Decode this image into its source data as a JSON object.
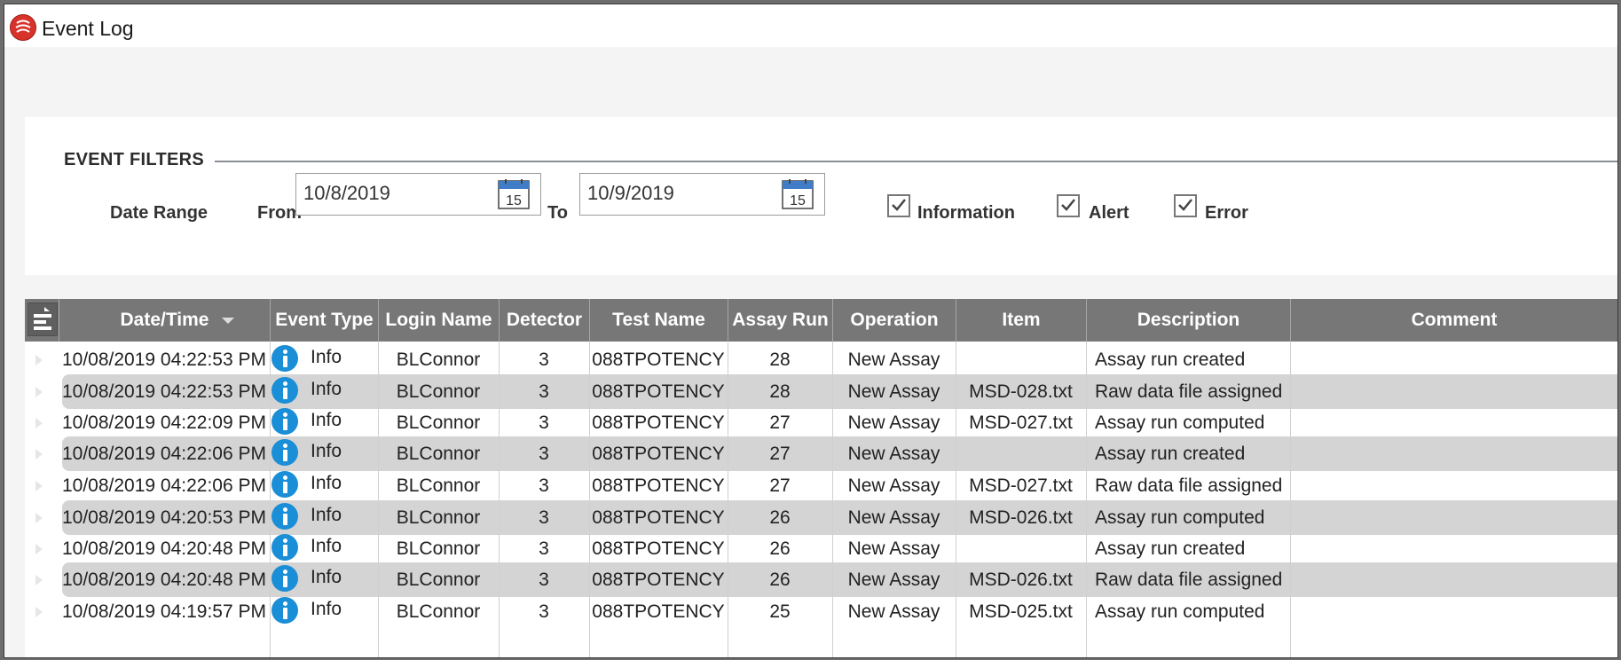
{
  "window": {
    "title": "Event Log"
  },
  "filters": {
    "section_title": "EVENT FILTERS",
    "date_range_label": "Date Range",
    "from_label": "From",
    "from_value": "10/8/2019",
    "to_label": "To",
    "to_value": "10/9/2019",
    "calendar_day": "15",
    "checkboxes": [
      {
        "label": "Information",
        "checked": true
      },
      {
        "label": "Alert",
        "checked": true
      },
      {
        "label": "Error",
        "checked": true
      }
    ]
  },
  "grid": {
    "columns": [
      "Date/Time",
      "Event Type",
      "Login Name",
      "Detector",
      "Test Name",
      "Assay Run",
      "Operation",
      "Item",
      "Description",
      "Comment"
    ],
    "sorted_column": "Date/Time",
    "sort_direction": "descending",
    "rows": [
      [
        "10/08/2019 04:22:53 PM",
        "Info",
        "BLConnor",
        "3",
        "088TPOTENCY",
        "28",
        "New Assay",
        "",
        "Assay run created",
        ""
      ],
      [
        "10/08/2019 04:22:53 PM",
        "Info",
        "BLConnor",
        "3",
        "088TPOTENCY",
        "28",
        "New Assay",
        "MSD-028.txt",
        "Raw data file assigned",
        ""
      ],
      [
        "10/08/2019 04:22:09 PM",
        "Info",
        "BLConnor",
        "3",
        "088TPOTENCY",
        "27",
        "New Assay",
        "MSD-027.txt",
        "Assay run computed",
        ""
      ],
      [
        "10/08/2019 04:22:06 PM",
        "Info",
        "BLConnor",
        "3",
        "088TPOTENCY",
        "27",
        "New Assay",
        "",
        "Assay run created",
        ""
      ],
      [
        "10/08/2019 04:22:06 PM",
        "Info",
        "BLConnor",
        "3",
        "088TPOTENCY",
        "27",
        "New Assay",
        "MSD-027.txt",
        "Raw data file assigned",
        ""
      ],
      [
        "10/08/2019 04:20:53 PM",
        "Info",
        "BLConnor",
        "3",
        "088TPOTENCY",
        "26",
        "New Assay",
        "MSD-026.txt",
        "Assay run computed",
        ""
      ],
      [
        "10/08/2019 04:20:48 PM",
        "Info",
        "BLConnor",
        "3",
        "088TPOTENCY",
        "26",
        "New Assay",
        "",
        "Assay run created",
        ""
      ],
      [
        "10/08/2019 04:20:48 PM",
        "Info",
        "BLConnor",
        "3",
        "088TPOTENCY",
        "26",
        "New Assay",
        "MSD-026.txt",
        "Raw data file assigned",
        ""
      ],
      [
        "10/08/2019 04:19:57 PM",
        "Info",
        "BLConnor",
        "3",
        "088TPOTENCY",
        "25",
        "New Assay",
        "MSD-025.txt",
        "Assay run computed",
        ""
      ]
    ]
  },
  "colors": {
    "header_bg": "#777777",
    "alt_row": "#d4d4d4",
    "info_icon": "#1a8ed6",
    "app_icon": "#d8332b"
  },
  "icons": {
    "app": "app-logo-icon",
    "calendar": "calendar-icon",
    "info": "info-icon",
    "column_chooser": "column-chooser-icon"
  }
}
